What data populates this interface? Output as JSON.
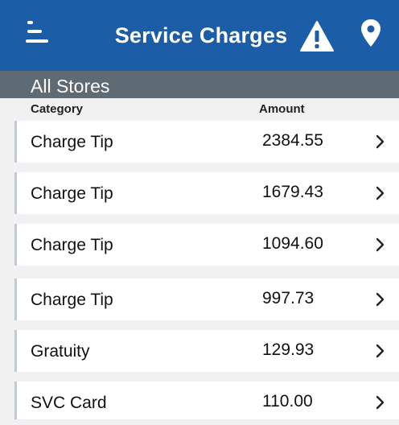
{
  "header": {
    "title": "Service Charges",
    "background": "#1b5da6",
    "icons": [
      "menu-icon",
      "warning-icon",
      "location-pin-icon"
    ]
  },
  "store_bar": {
    "label": "All Stores",
    "background": "#5e6a74"
  },
  "columns": {
    "category": "Category",
    "amount": "Amount"
  },
  "rows": [
    {
      "category": "Charge Tip",
      "amount": "2384.55"
    },
    {
      "category": "Charge Tip",
      "amount": "1679.43"
    },
    {
      "category": "Charge Tip",
      "amount": "1094.60"
    },
    {
      "category": "Charge Tip",
      "amount": "997.73"
    },
    {
      "category": "Gratuity",
      "amount": "129.93"
    },
    {
      "category": "SVC Card",
      "amount": "110.00"
    }
  ]
}
